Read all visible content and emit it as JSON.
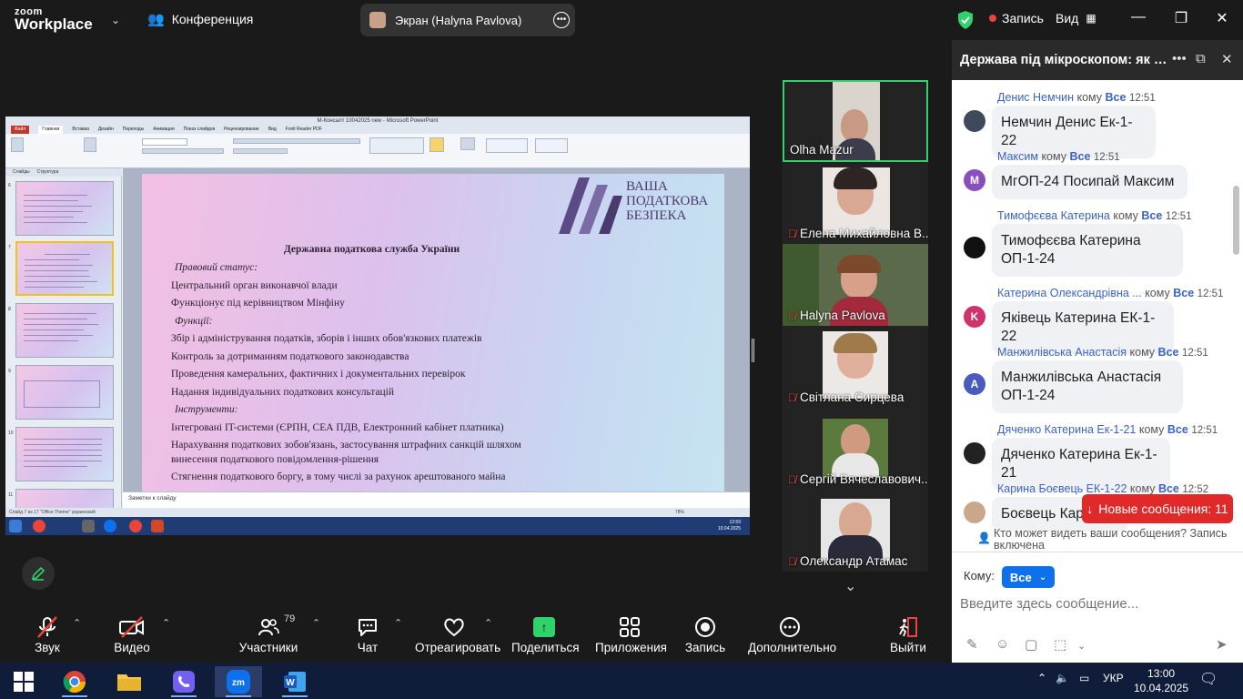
{
  "app": {
    "logo_small": "zoom",
    "logo_big": "Workplace",
    "conference_label": "Конференция",
    "screen_label": "Экран (Halyna Pavlova)",
    "record_label": "Запись",
    "view_label": "Вид"
  },
  "shared_screen": {
    "ppt_title": "M-Консалт 10042025 new - Microsoft PowerPoint",
    "tabs": [
      "Файл",
      "Главная",
      "Вставка",
      "Дизайн",
      "Переходы",
      "Анимация",
      "Показ слайдов",
      "Рецензирование",
      "Вид",
      "Foxit Reader PDF"
    ],
    "pane_tabs": [
      "Слайды",
      "Структура"
    ],
    "thumb_numbers": [
      "6",
      "7",
      "8",
      "9",
      "10",
      "11"
    ],
    "slide": {
      "brand_line1": "ВАША",
      "brand_line2": "ПОДАТКОВА",
      "brand_line3": "БЕЗПЕКА",
      "title": "Державна податкова служба України",
      "lines": [
        {
          "text": "Правовий статус:",
          "italic": true
        },
        {
          "text": "Центральний орган виконавчої влади",
          "italic": false
        },
        {
          "text": "Функціонує під керівництвом Мінфіну",
          "italic": false
        },
        {
          "text": "Функції:",
          "italic": true
        },
        {
          "text": "Збір і адміністрування податків, зборів і інших обов'язкових платежів",
          "italic": false
        },
        {
          "text": "Контроль за дотриманням податкового законодавства",
          "italic": false
        },
        {
          "text": "Проведення камеральних, фактичних і документальних перевірок",
          "italic": false
        },
        {
          "text": "Надання індивідуальних податкових консультацій",
          "italic": false
        },
        {
          "text": "Інструменти:",
          "italic": true
        },
        {
          "text": "Інтегровані IT-системи (ЄРПН, СЕА ПДВ, Електронний кабінет платника)",
          "italic": false
        },
        {
          "text": "Нарахування податкових зобов'язань, застосування штрафних санкцій шляхом",
          "italic": false
        },
        {
          "text": "винесення податкового повідомлення-рішення",
          "italic": false
        },
        {
          "text": "Стягнення податкового боргу, в тому числі за рахунок арештованого майна",
          "italic": false
        }
      ]
    },
    "notes_placeholder": "Заметки к слайду",
    "status_left": "Слайд 7 из 17    \"Office Theme\"    украинский",
    "status_zoom": "78%",
    "vm_time": "12:59",
    "vm_date": "10.04.2025"
  },
  "gallery": [
    {
      "name": "Olha Mazur",
      "muted": false,
      "active": true
    },
    {
      "name": "Елена Михайловна В...",
      "muted": true,
      "active": false
    },
    {
      "name": "Halyna Pavlova",
      "muted": true,
      "active": false
    },
    {
      "name": "Світлана Сирцева",
      "muted": true,
      "active": false
    },
    {
      "name": "Сергій Вячеславович...",
      "muted": true,
      "active": false
    },
    {
      "name": "Олександр Атамас",
      "muted": true,
      "active": false
    }
  ],
  "chat": {
    "title": "Держава під мікроскопом: як пр...",
    "messages": [
      {
        "sender": "Денис Немчин",
        "to": "кому",
        "all": "Все",
        "time": "12:51",
        "text": "Немчин Денис Ек-1-22",
        "avatar": "",
        "avatar_color": "#3c4a5c"
      },
      {
        "sender": "Максим",
        "to": "кому",
        "all": "Все",
        "time": "12:51",
        "text": "МгОП-24 Посипай Максим",
        "avatar": "M",
        "avatar_color": "#8a4fbf"
      },
      {
        "sender": "Тимофєєва Катерина",
        "to": "кому",
        "all": "Все",
        "time": "12:51",
        "text": "Тимофєєва Катерина ОП-1-24",
        "avatar": "",
        "avatar_color": "#111111"
      },
      {
        "sender": "Катерина Олександрівна ...",
        "to": "кому",
        "all": "Все",
        "time": "12:51",
        "text": "Яківець Катерина ЕК-1-22",
        "avatar": "K",
        "avatar_color": "#d0336c"
      },
      {
        "sender": "Манжилівська Анастасія",
        "to": "кому",
        "all": "Все",
        "time": "12:51",
        "text": "Манжилівська Анастасія ОП-1-24",
        "avatar": "A",
        "avatar_color": "#4a5bbf"
      },
      {
        "sender": "Дяченко Катерина Ек-1-21",
        "to": "кому",
        "all": "Все",
        "time": "12:51",
        "text": "Дяченко Катерина Ек-1-21",
        "avatar": "",
        "avatar_color": "#222222"
      },
      {
        "sender": "Карина Боєвець ЕК-1-22",
        "to": "кому",
        "all": "Все",
        "time": "12:52",
        "text": "Боєвець Кар",
        "avatar": "",
        "avatar_color": "#c9a88a"
      }
    ],
    "new_messages_label": "Новые сообщения: 11",
    "who_can_see": "Кто может видеть ваши сообщения? Запись включена",
    "to_label": "Кому:",
    "to_value": "Все",
    "input_placeholder": "Введите здесь сообщение..."
  },
  "toolbar": {
    "audio": "Звук",
    "video": "Видео",
    "participants": "Участники",
    "participants_count": "79",
    "chat": "Чат",
    "react": "Отреагировать",
    "share": "Поделиться",
    "apps": "Приложения",
    "record": "Запись",
    "more": "Дополнительно",
    "leave": "Выйти"
  },
  "taskbar": {
    "lang": "УКР",
    "time": "13:00",
    "date": "10.04.2025"
  },
  "colors": {
    "accent_blue": "#0e71eb",
    "active_green": "#2fd26b",
    "alert_red": "#e02a2a"
  }
}
